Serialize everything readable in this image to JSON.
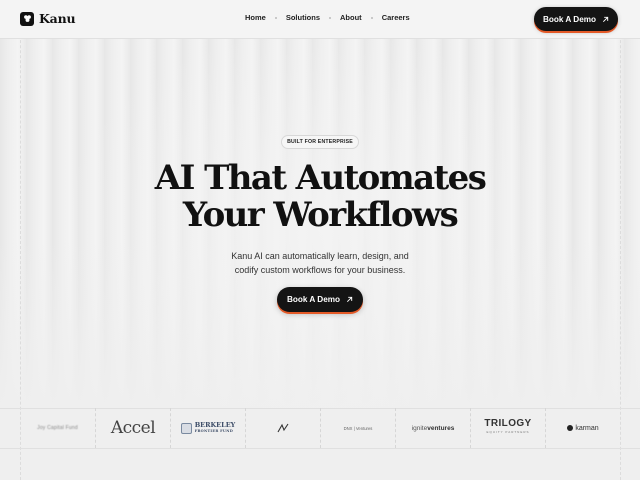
{
  "brand": {
    "name": "Kanu"
  },
  "nav": {
    "items": [
      "Home",
      "Solutions",
      "About",
      "Careers"
    ]
  },
  "header": {
    "cta_label": "Book A Demo"
  },
  "hero": {
    "badge": "BUILT FOR ENTERPRISE",
    "title_line1": "AI That Automates",
    "title_line2": "Your Workflows",
    "subtitle_line1": "Kanu AI can automatically learn, design, and",
    "subtitle_line2": "codify custom workflows for your business.",
    "cta_label": "Book A Demo"
  },
  "partners": [
    {
      "name": "blurred-partner",
      "text": "Joy Capital Fund"
    },
    {
      "name": "accel",
      "text": "Accel"
    },
    {
      "name": "berkeley",
      "text": "BERKELEY",
      "subtext": "FRONTIER FUND"
    },
    {
      "name": "small-partner",
      "text": ""
    },
    {
      "name": "venture-pair",
      "text": "DNX | Ventures"
    },
    {
      "name": "ignite",
      "text": "ignite",
      "bold": "ventures"
    },
    {
      "name": "trilogy",
      "text": "TRILOGY",
      "subtext": "EQUITY PARTNERS"
    },
    {
      "name": "karman",
      "text": "karman"
    }
  ],
  "colors": {
    "accent": "#e45a28",
    "button_bg": "#141414",
    "page_bg": "#efefef"
  },
  "icons": [
    "kanu-logo-icon",
    "arrow-up-right-icon"
  ]
}
